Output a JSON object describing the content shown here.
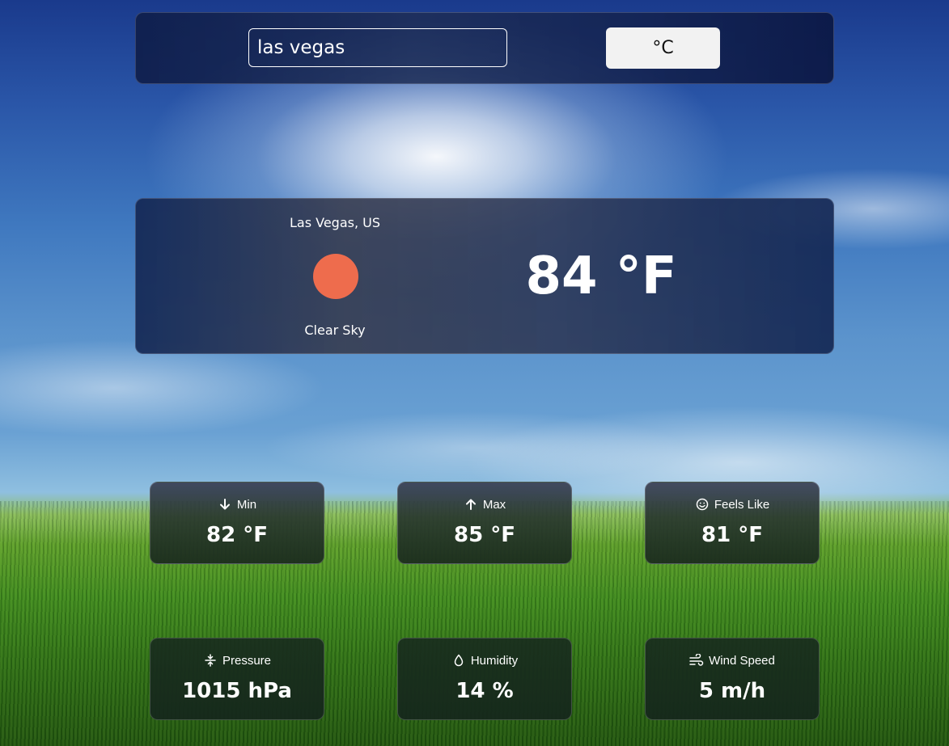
{
  "search": {
    "value": "las vegas"
  },
  "unit_toggle": {
    "label": "°C"
  },
  "current": {
    "location": "Las Vegas, US",
    "condition": "Clear Sky",
    "temperature": "84 °F",
    "condition_icon": "sun-icon",
    "sun_color": "#ee6c4d"
  },
  "stats": [
    {
      "label": "Min",
      "value": "82 °F",
      "icon": "arrow-down-icon"
    },
    {
      "label": "Max",
      "value": "85 °F",
      "icon": "arrow-up-icon"
    },
    {
      "label": "Feels Like",
      "value": "81 °F",
      "icon": "smiley-icon"
    },
    {
      "label": "Pressure",
      "value": "1015 hPa",
      "icon": "pressure-icon"
    },
    {
      "label": "Humidity",
      "value": "14 %",
      "icon": "droplet-icon"
    },
    {
      "label": "Wind Speed",
      "value": "5 m/h",
      "icon": "wind-icon"
    }
  ]
}
